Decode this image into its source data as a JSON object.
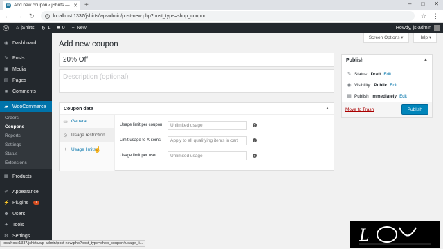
{
  "browser": {
    "tab_title": "Add new coupon ‹ jShirts — Wo",
    "url": "localhost:1337/jshirts/wp-admin/post-new.php?post_type=shop_coupon",
    "status_url": "localhost:1337/jshirts/wp-admin/post-new.php?post_type=shop_coupon#usage_li..."
  },
  "adminbar": {
    "site_name": "jShirts",
    "updates": "1",
    "comments": "0",
    "new_label": "New",
    "howdy": "Howdy, js-admin"
  },
  "sidebar": {
    "items_top": [
      {
        "label": "Dashboard",
        "icon": "dashboard-icon"
      },
      {
        "label": "Posts",
        "icon": "pin-icon"
      },
      {
        "label": "Media",
        "icon": "media-icon"
      },
      {
        "label": "Pages",
        "icon": "page-icon"
      },
      {
        "label": "Comments",
        "icon": "comment-icon"
      }
    ],
    "woocommerce": "WooCommerce",
    "sub": [
      "Orders",
      "Coupons",
      "Reports",
      "Settings",
      "Status",
      "Extensions"
    ],
    "items_bottom": [
      {
        "label": "Products",
        "icon": "box-icon"
      },
      {
        "label": "Appearance",
        "icon": "brush-icon"
      },
      {
        "label": "Plugins",
        "icon": "plugin-icon",
        "badge": "1"
      },
      {
        "label": "Users",
        "icon": "user-icon"
      },
      {
        "label": "Tools",
        "icon": "wrench-icon"
      },
      {
        "label": "Settings",
        "icon": "settings-icon"
      }
    ]
  },
  "header": {
    "screen_options": "Screen Options ▾",
    "help": "Help ▾",
    "title": "Add new coupon"
  },
  "coupon": {
    "code": "20% Off",
    "description_placeholder": "Description (optional)"
  },
  "coupon_data": {
    "title": "Coupon data",
    "tabs": [
      {
        "label": "General",
        "icon": "ticket-icon"
      },
      {
        "label": "Usage restriction",
        "icon": "ban-icon"
      },
      {
        "label": "Usage limits",
        "icon": "plus-icon"
      }
    ],
    "fields": [
      {
        "label": "Usage limit per coupon",
        "placeholder": "Unlimited usage"
      },
      {
        "label": "Limit usage to X items",
        "placeholder": "Apply to all qualifying items in cart"
      },
      {
        "label": "Usage limit per user",
        "placeholder": "Unlimited usage"
      }
    ]
  },
  "publish": {
    "title": "Publish",
    "status_label": "Status:",
    "status_value": "Draft",
    "visibility_label": "Visibility:",
    "visibility_value": "Public",
    "publish_label": "Publish",
    "publish_value": "immediately",
    "edit": "Edit",
    "trash": "Move to Trash",
    "button": "Publish"
  },
  "colors": {
    "admin_dark": "#23282d",
    "accent": "#0073aa",
    "publish_button": "#0085ba"
  }
}
